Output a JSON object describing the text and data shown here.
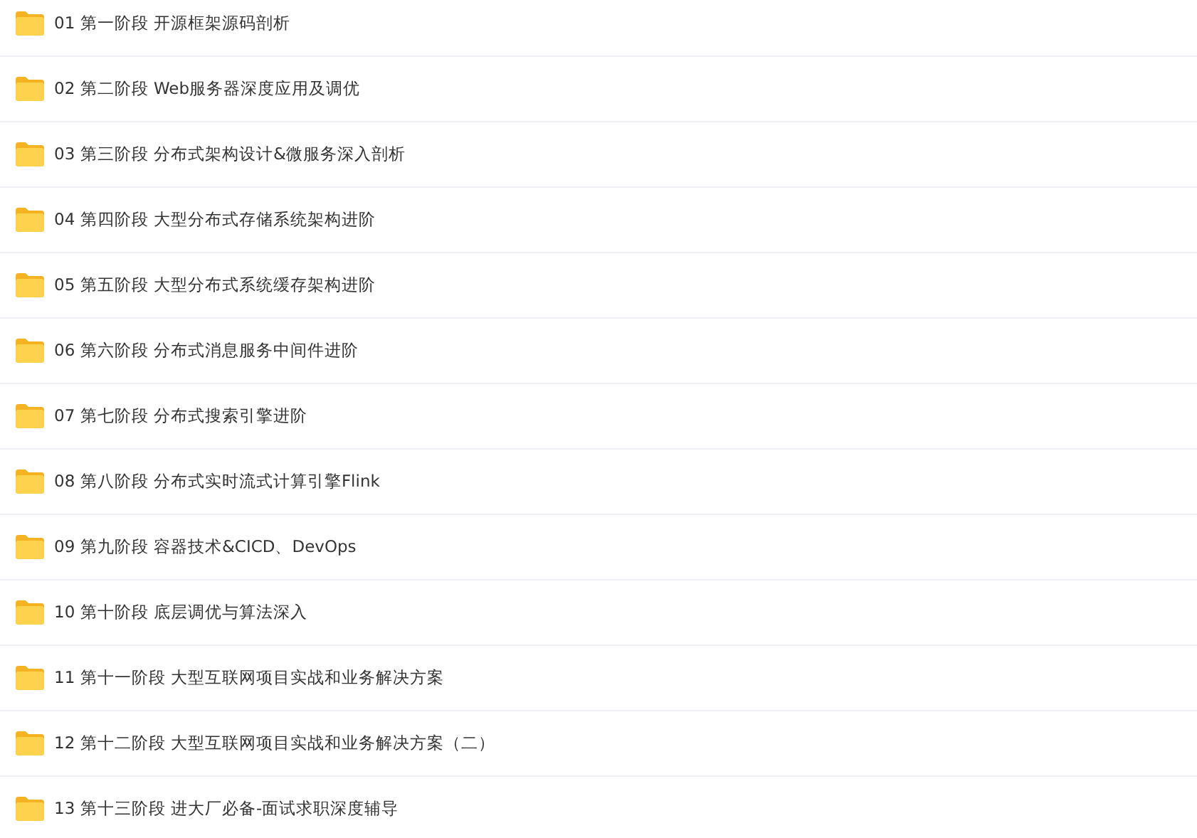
{
  "folders": [
    {
      "name": "01 第一阶段 开源框架源码剖析"
    },
    {
      "name": "02 第二阶段 Web服务器深度应用及调优"
    },
    {
      "name": "03 第三阶段 分布式架构设计&微服务深入剖析"
    },
    {
      "name": "04 第四阶段 大型分布式存储系统架构进阶"
    },
    {
      "name": "05 第五阶段 大型分布式系统缓存架构进阶"
    },
    {
      "name": "06 第六阶段 分布式消息服务中间件进阶"
    },
    {
      "name": "07 第七阶段 分布式搜索引擎进阶"
    },
    {
      "name": "08 第八阶段 分布式实时流式计算引擎Flink"
    },
    {
      "name": "09 第九阶段 容器技术&CICD、DevOps"
    },
    {
      "name": "10 第十阶段 底层调优与算法深入"
    },
    {
      "name": "11 第十一阶段 大型互联网项目实战和业务解决方案"
    },
    {
      "name": "12 第十二阶段 大型互联网项目实战和业务解决方案（二）"
    },
    {
      "name": "13 第十三阶段 进大厂必备-面试求职深度辅导"
    }
  ]
}
